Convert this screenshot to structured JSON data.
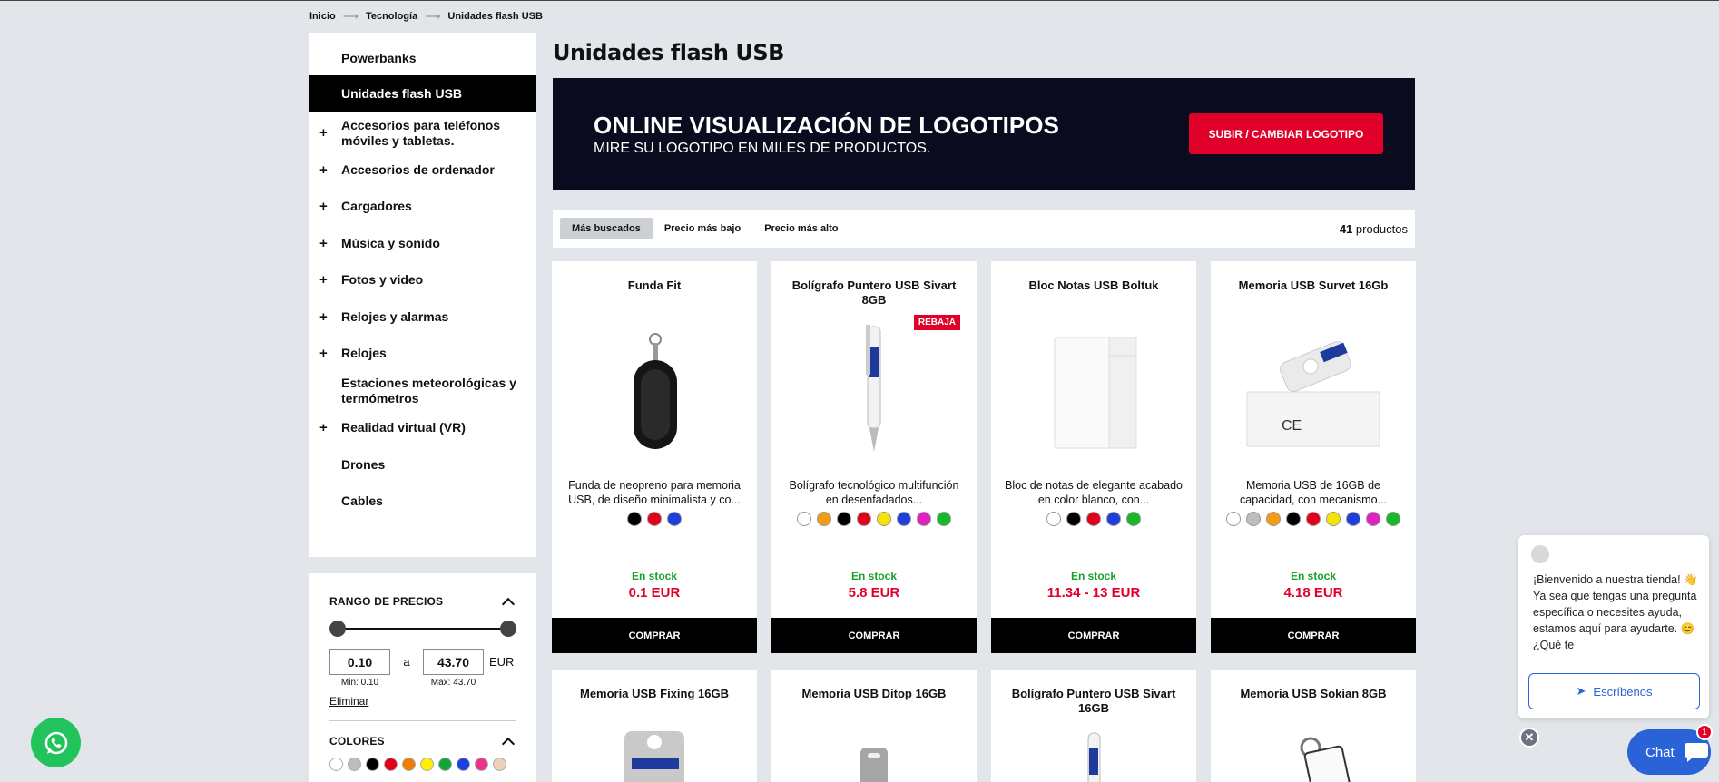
{
  "breadcrumb": [
    "Inicio",
    "Tecnología",
    "Unidades flash USB"
  ],
  "sidebar": {
    "items": [
      {
        "label": "Powerbanks",
        "plus": false,
        "active": false
      },
      {
        "label": "Unidades flash USB",
        "plus": false,
        "active": true
      },
      {
        "label": "Accesorios para teléfonos móviles y tabletas.",
        "plus": true,
        "active": false
      },
      {
        "label": "Accesorios de ordenador",
        "plus": true,
        "active": false
      },
      {
        "label": "Cargadores",
        "plus": true,
        "active": false
      },
      {
        "label": "Música y sonido",
        "plus": true,
        "active": false
      },
      {
        "label": "Fotos y video",
        "plus": true,
        "active": false
      },
      {
        "label": "Relojes y alarmas",
        "plus": true,
        "active": false
      },
      {
        "label": "Relojes",
        "plus": true,
        "active": false
      },
      {
        "label": "Estaciones meteorológicas y termómetros",
        "plus": false,
        "active": false
      },
      {
        "label": "Realidad virtual (VR)",
        "plus": true,
        "active": false
      },
      {
        "label": "Drones",
        "plus": false,
        "active": false
      },
      {
        "label": "Cables",
        "plus": false,
        "active": false
      }
    ]
  },
  "price_filter": {
    "title": "RANGO DE PRECIOS",
    "min_value": "0.10",
    "max_value": "43.70",
    "separator": "a",
    "currency": "EUR",
    "min_label": "Min: 0.10",
    "max_label": "Max: 43.70",
    "clear": "Eliminar"
  },
  "color_filter": {
    "title": "COLORES",
    "colors": [
      "#ffffff",
      "#bdbdbd",
      "#000000",
      "#e3001b",
      "#f07c00",
      "#ffee00",
      "#12a537",
      "#1d3fdc",
      "#e8348a",
      "#ecd3b6"
    ]
  },
  "page_title": "Unidades flash USB",
  "banner": {
    "title": "ONLINE VISUALIZACIÓN DE LOGOTIPOS",
    "subtitle": "MIRE SU LOGOTIPO EN MILES DE PRODUCTOS.",
    "button": "SUBIR / CAMBIAR LOGOTIPO"
  },
  "sort": {
    "options": [
      "Más buscados",
      "Precio más bajo",
      "Precio más alto"
    ],
    "selected": 0,
    "count": "41",
    "count_label": "productos"
  },
  "products": [
    {
      "name": "Funda Fit",
      "desc": "Funda de neopreno para memoria USB, de diseño minimalista y co...",
      "colors": [
        "#000000",
        "#e3001b",
        "#1d3fdc"
      ],
      "stock": "En stock",
      "price": "0.1 EUR",
      "buy": "COMPRAR",
      "badge": "",
      "image": "pouch"
    },
    {
      "name": "Bolígrafo Puntero USB Sivart 8GB",
      "desc": "Bolígrafo tecnológico multifunción en desenfadados...",
      "colors": [
        "#ffffff",
        "#f39c12",
        "#000000",
        "#e3001b",
        "#f5e400",
        "#1d3fdc",
        "#e020c0",
        "#17b82a"
      ],
      "stock": "En stock",
      "price": "5.8 EUR",
      "buy": "COMPRAR",
      "badge": "REBAJA",
      "image": "pen"
    },
    {
      "name": "Bloc Notas USB Boltuk",
      "desc": "Bloc de notas de elegante acabado en color blanco, con...",
      "colors": [
        "#ffffff",
        "#000000",
        "#e3001b",
        "#1d3fdc",
        "#17b82a"
      ],
      "stock": "En stock",
      "price": "11.34 - 13 EUR",
      "buy": "COMPRAR",
      "badge": "",
      "image": "notebook"
    },
    {
      "name": "Memoria USB Survet 16Gb",
      "desc": "Memoria USB de 16GB de capacidad, con mecanismo...",
      "colors": [
        "#ffffff",
        "#bdbdbd",
        "#f39c12",
        "#000000",
        "#e3001b",
        "#f5e400",
        "#1d3fdc",
        "#e020c0",
        "#17b82a"
      ],
      "stock": "En stock",
      "price": "4.18 EUR",
      "buy": "COMPRAR",
      "badge": "",
      "image": "usb"
    },
    {
      "name": "Memoria USB Fixing 16GB",
      "image": "usbcard"
    },
    {
      "name": "Memoria USB Ditop 16GB",
      "image": "usbsilver"
    },
    {
      "name": "Bolígrafo Puntero USB Sivart 16GB",
      "image": "pen"
    },
    {
      "name": "Memoria USB Sokian 8GB",
      "image": "usbring"
    }
  ],
  "chat": {
    "message": "¡Bienvenido a nuestra tienda! 👋 Ya sea que tengas una pregunta específica o necesites ayuda, estamos aquí para ayudarte. 😊 ¿Qué te",
    "write_button": "Escríbenos",
    "chat_label": "Chat",
    "badge": "1"
  },
  "icons": {
    "whatsapp": "whatsapp-icon",
    "close": "close-icon",
    "send": "send-icon",
    "chat": "chat-bubble-icon"
  }
}
